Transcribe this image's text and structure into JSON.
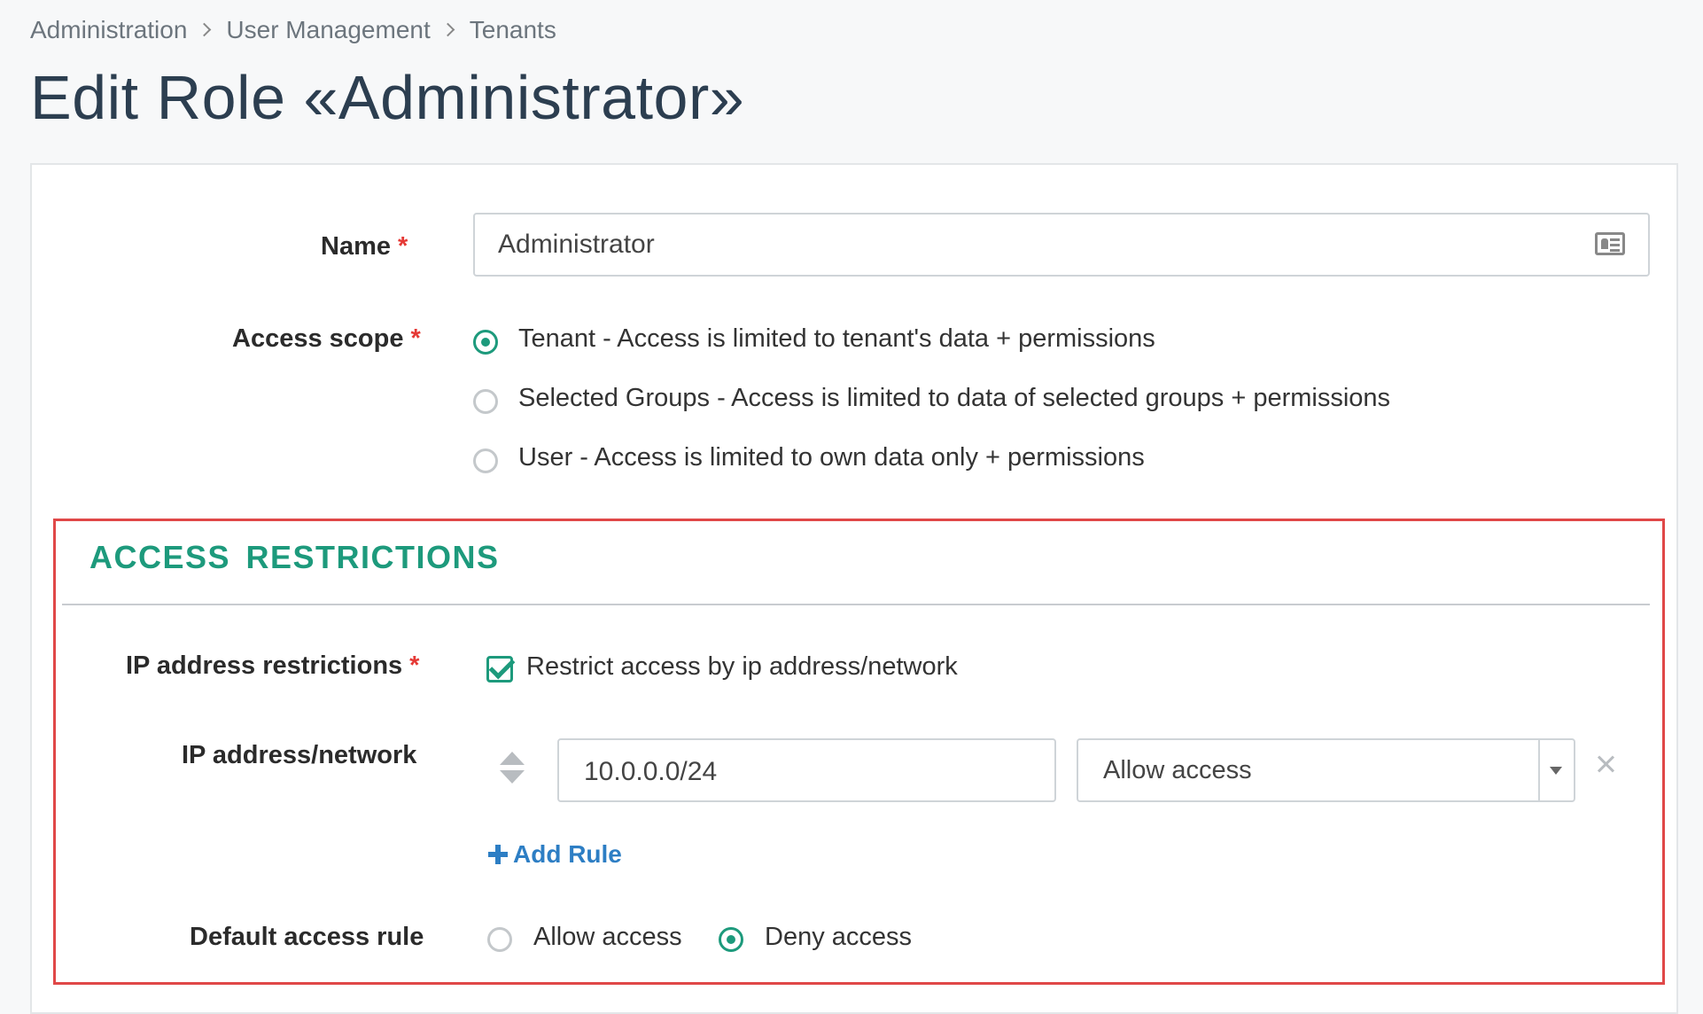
{
  "breadcrumb": {
    "items": [
      "Administration",
      "User Management",
      "Tenants"
    ]
  },
  "page": {
    "title": "Edit Role «Administrator»"
  },
  "form": {
    "name": {
      "label": "Name",
      "required_mark": "*",
      "value": "Administrator"
    },
    "access_scope": {
      "label": "Access scope",
      "required_mark": "*",
      "options": [
        {
          "label": "Tenant - Access is limited to tenant's data + permissions",
          "checked": true
        },
        {
          "label": "Selected Groups - Access is limited to data of selected groups + permissions",
          "checked": false
        },
        {
          "label": "User - Access is limited to own data only + permissions",
          "checked": false
        }
      ]
    }
  },
  "access_restrictions": {
    "title": "ACCESS RESTRICTIONS",
    "ip_restrictions": {
      "label": "IP address restrictions",
      "required_mark": "*",
      "checkbox_label": "Restrict access by ip address/network",
      "checked": true
    },
    "ip_network": {
      "label": "IP address/network",
      "rules": [
        {
          "address": "10.0.0.0/24",
          "action": "Allow access"
        }
      ]
    },
    "add_rule_label": "Add Rule",
    "default_rule": {
      "label": "Default access rule",
      "options": [
        {
          "label": "Allow access",
          "checked": false
        },
        {
          "label": "Deny access",
          "checked": true
        }
      ]
    }
  },
  "colors": {
    "accent": "#1d9a7c",
    "link": "#2d7ec4",
    "required": "#e53935",
    "highlight_border": "#e04848",
    "title": "#2c3e50"
  },
  "icons": [
    "chevron-right-icon",
    "id-card-icon",
    "sort-handle-icon",
    "chevron-down-icon",
    "close-icon",
    "plus-icon",
    "checkmark-icon"
  ]
}
